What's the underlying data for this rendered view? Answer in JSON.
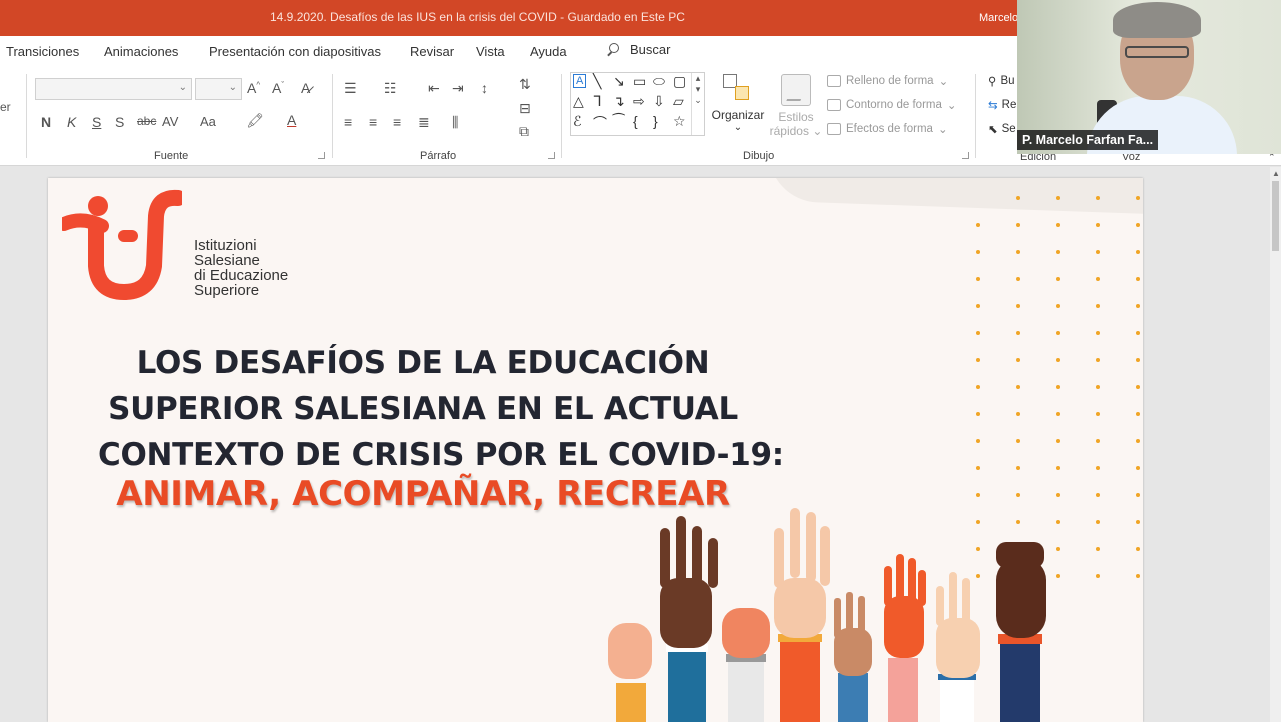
{
  "titlebar": {
    "document_title": "14.9.2020. Desafíos de las IUS en la crisis del COVID  -  Guardado en Este PC",
    "user": "Marcelo"
  },
  "ribbon_tabs": [
    "Transiciones",
    "Animaciones",
    "Presentación con diapositivas",
    "Revisar",
    "Vista",
    "Ayuda"
  ],
  "search": {
    "label": "Buscar"
  },
  "ribbon": {
    "left_cut_label": "er",
    "groups": {
      "fuente": "Fuente",
      "parrafo": "Párrafo",
      "dibujo": "Dibujo",
      "edicion": "Edición",
      "voz": "Voz"
    },
    "font_buttons": [
      "N",
      "K",
      "S",
      "S",
      "abc",
      "AV",
      "Aa"
    ],
    "organizar": "Organizar",
    "estilos_rapidos": [
      "Estilos",
      "rápidos"
    ],
    "format_items": [
      "Relleno de forma",
      "Contorno de forma",
      "Efectos de forma"
    ],
    "edit_items": [
      "Bu",
      "Re",
      "Se"
    ]
  },
  "video": {
    "participant_name": "P. Marcelo Farfan Fa..."
  },
  "slide": {
    "logo_lines": [
      "Istituzioni",
      "Salesiane",
      "di Educazione",
      "Superiore"
    ],
    "headline_lines": [
      "LOS DESAFÍOS DE LA EDUCACIÓN",
      "SUPERIOR SALESIANA EN EL ACTUAL",
      "CONTEXTO DE CRISIS POR EL COVID-19:"
    ],
    "subline": "ANIMAR, ACOMPAÑAR, RECREAR"
  },
  "colors": {
    "accent": "#d24726",
    "headline": "#232631",
    "subline": "#e94b25",
    "dots": "#f0a526"
  }
}
